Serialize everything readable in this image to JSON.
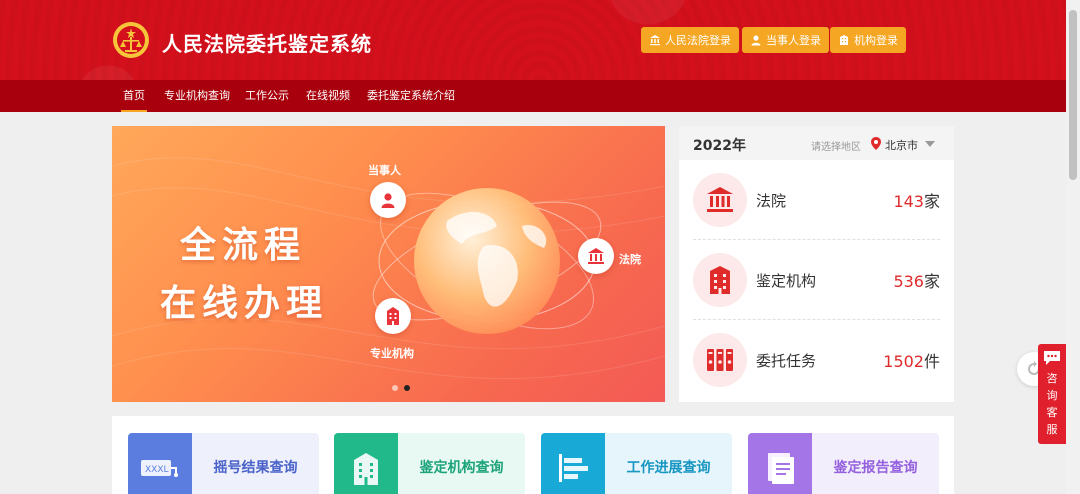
{
  "header": {
    "title": "人民法院委托鉴定系统",
    "login_buttons": [
      {
        "label": "人民法院登录",
        "icon": "court-icon"
      },
      {
        "label": "当事人登录",
        "icon": "person-icon"
      },
      {
        "label": "机构登录",
        "icon": "building-icon"
      }
    ]
  },
  "nav": {
    "items": [
      "首页",
      "专业机构查询",
      "工作公示",
      "在线视频",
      "委托鉴定系统介绍"
    ],
    "active_index": 0
  },
  "banner": {
    "line1": "全流程",
    "line2": "在线办理",
    "labels": {
      "party": "当事人",
      "court": "法院",
      "agency": "专业机构"
    },
    "slide_count": 2,
    "active_slide": 1
  },
  "stats": {
    "year": "2022年",
    "region_label": "请选择地区",
    "city": "北京市",
    "rows": [
      {
        "label": "法院",
        "value": "143",
        "unit": "家",
        "icon": "court-icon"
      },
      {
        "label": "鉴定机构",
        "value": "536",
        "unit": "家",
        "icon": "office-building-icon"
      },
      {
        "label": "委托任务",
        "value": "1502",
        "unit": "件",
        "icon": "file-binders-icon"
      }
    ]
  },
  "quick_links": [
    {
      "label": "摇号结果查询",
      "icon": "lottery-icon",
      "color": "#5b7de0",
      "bg": "#eef0fc",
      "text_color": "#4a63c9"
    },
    {
      "label": "鉴定机构查询",
      "icon": "building-icon",
      "color": "#21b98a",
      "bg": "#e8f8f2",
      "text_color": "#1ca37a"
    },
    {
      "label": "工作进展查询",
      "icon": "progress-icon",
      "color": "#18a9d6",
      "bg": "#e6f5fb",
      "text_color": "#1796c2"
    },
    {
      "label": "鉴定报告查询",
      "icon": "report-icon",
      "color": "#a375e6",
      "bg": "#f3eefc",
      "text_color": "#9460de"
    }
  ],
  "consult": {
    "label": "咨询客服"
  },
  "colors": {
    "brand_red": "#d4101c",
    "nav_red": "#a8000c",
    "accent_orange": "#f5a623",
    "number_red": "#e02b2b"
  }
}
